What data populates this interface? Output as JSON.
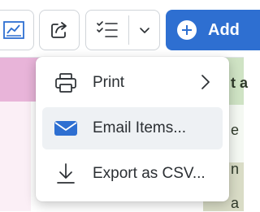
{
  "toolbar": {
    "add_label": "Add",
    "accent_color": "#2e6fd1"
  },
  "menu": {
    "items": [
      {
        "label": "Print",
        "icon": "printer-icon",
        "has_submenu": true
      },
      {
        "label": "Email Items...",
        "icon": "envelope-icon",
        "has_submenu": false
      },
      {
        "label": "Export as CSV...",
        "icon": "download-icon",
        "has_submenu": false
      }
    ]
  },
  "background": {
    "peek_texts": [
      "t a",
      "e",
      "n",
      "a"
    ]
  }
}
